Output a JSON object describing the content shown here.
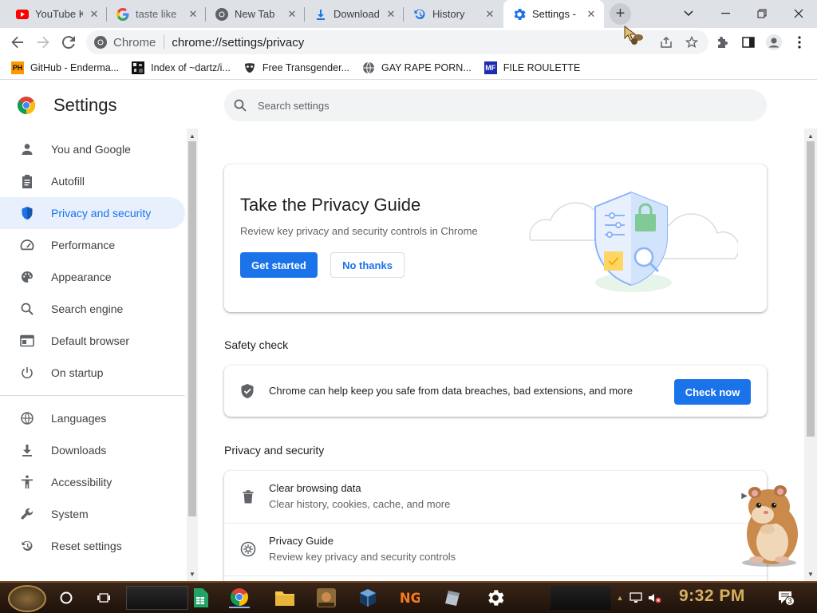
{
  "tabs": [
    {
      "title": "YouTube K",
      "icon": "youtube-icon"
    },
    {
      "title": "taste like",
      "icon": "google-icon"
    },
    {
      "title": "New Tab",
      "icon": "chrome-icon"
    },
    {
      "title": "Downloads",
      "icon": "download-icon"
    },
    {
      "title": "History",
      "icon": "history-icon"
    },
    {
      "title": "Settings -",
      "icon": "gear-icon"
    }
  ],
  "omnibox": {
    "site": "Chrome",
    "url": "chrome://settings/privacy"
  },
  "bookmarks": [
    {
      "label": "GitHub - Enderma...",
      "icon": "ph-icon",
      "badge": "PH"
    },
    {
      "label": "Index of ~dartz/i...",
      "icon": "pixel-art-icon"
    },
    {
      "label": "Free Transgender...",
      "icon": "mask-icon"
    },
    {
      "label": "GAY RAPE PORN...",
      "icon": "globe-icon"
    },
    {
      "label": "FILE ROULETTE",
      "icon": "file-roulette-icon",
      "badge": "MF"
    }
  ],
  "settings": {
    "title": "Settings",
    "search_placeholder": "Search settings"
  },
  "sidebar": {
    "group1": [
      {
        "label": "You and Google",
        "icon": "person-icon"
      },
      {
        "label": "Autofill",
        "icon": "clipboard-icon"
      },
      {
        "label": "Privacy and security",
        "icon": "shield-icon",
        "selected": true
      },
      {
        "label": "Performance",
        "icon": "speedometer-icon"
      },
      {
        "label": "Appearance",
        "icon": "palette-icon"
      },
      {
        "label": "Search engine",
        "icon": "search-icon"
      },
      {
        "label": "Default browser",
        "icon": "browser-icon"
      },
      {
        "label": "On startup",
        "icon": "power-icon"
      }
    ],
    "group2": [
      {
        "label": "Languages",
        "icon": "globe-icon"
      },
      {
        "label": "Downloads",
        "icon": "download-icon"
      },
      {
        "label": "Accessibility",
        "icon": "accessibility-icon"
      },
      {
        "label": "System",
        "icon": "wrench-icon"
      },
      {
        "label": "Reset settings",
        "icon": "reset-icon"
      }
    ]
  },
  "privacy_guide": {
    "title": "Take the Privacy Guide",
    "description": "Review key privacy and security controls in Chrome",
    "primary_button": "Get started",
    "secondary_button": "No thanks"
  },
  "safety_check": {
    "section_title": "Safety check",
    "text": "Chrome can help keep you safe from data breaches, bad extensions, and more",
    "button": "Check now"
  },
  "privacy_security": {
    "section_title": "Privacy and security",
    "rows": [
      {
        "title": "Clear browsing data",
        "subtitle": "Clear history, cookies, cache, and more",
        "icon": "trash-icon"
      },
      {
        "title": "Privacy Guide",
        "subtitle": "Review key privacy and security controls",
        "icon": "privacy-guide-icon"
      }
    ]
  },
  "taskbar": {
    "clock": "9:32 PM",
    "notification_count": "3"
  },
  "colors": {
    "accent": "#1a73e8",
    "selected_bg": "#e8f0fe",
    "tabstrip": "#dee1e6"
  }
}
